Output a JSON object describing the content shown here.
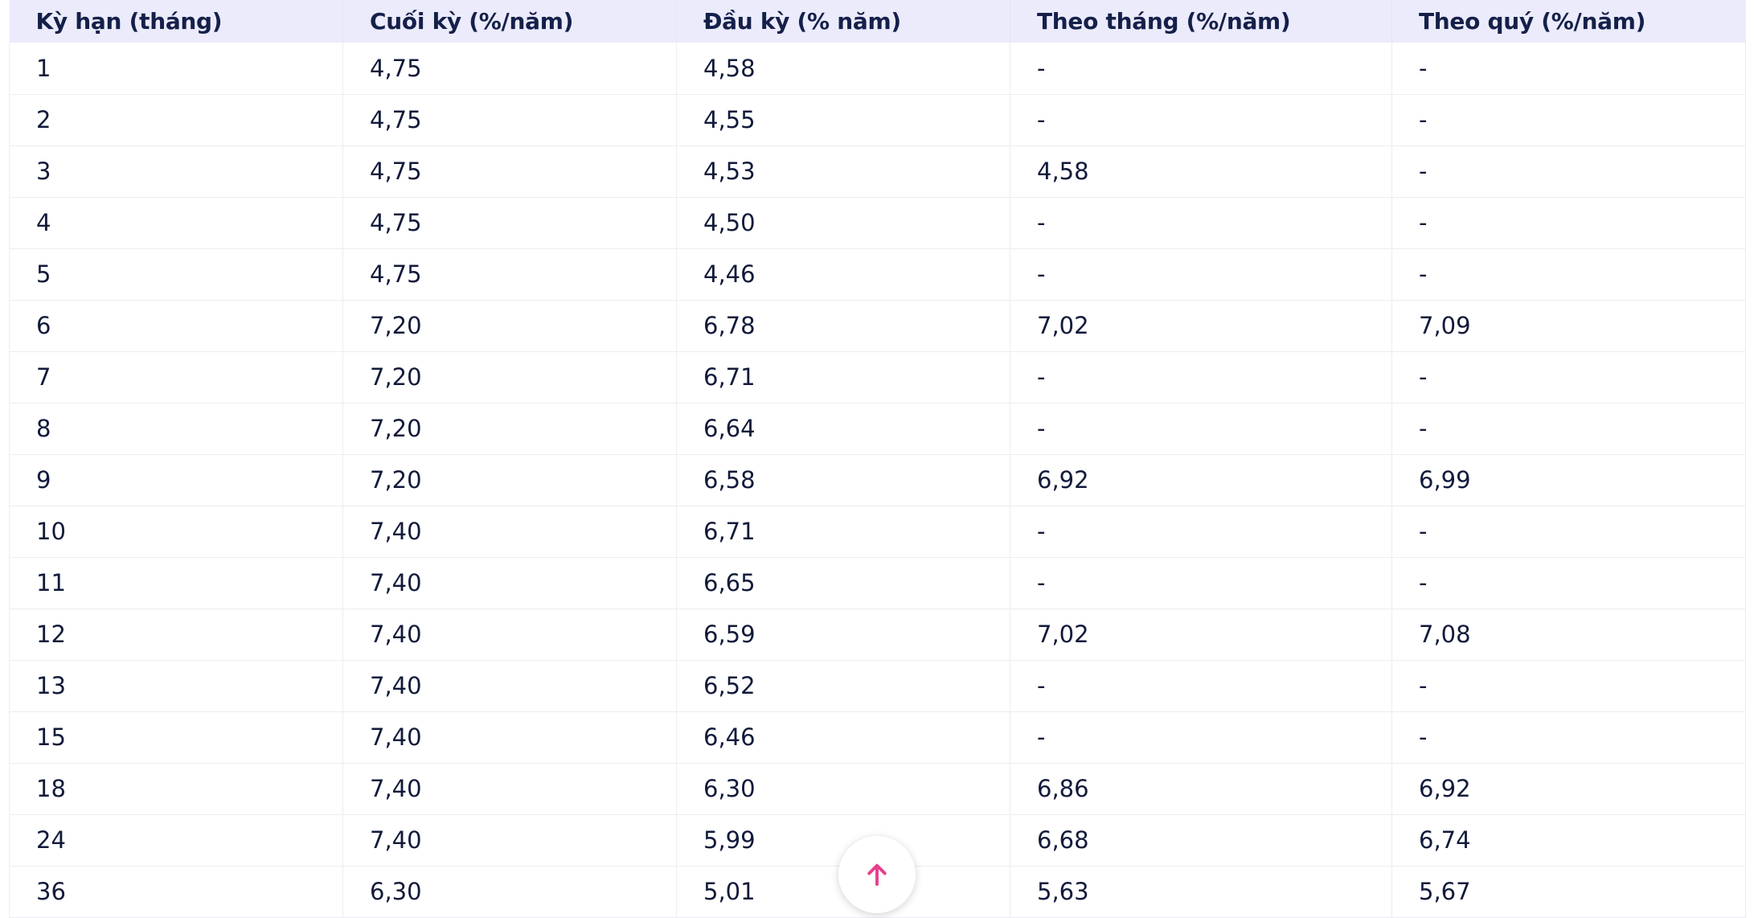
{
  "table": {
    "headers": [
      "Kỳ hạn (tháng)",
      "Cuối kỳ (%/năm)",
      "Đầu kỳ (% năm)",
      "Theo tháng (%/năm)",
      "Theo quý (%/năm)"
    ],
    "rows": [
      [
        "1",
        "4,75",
        "4,58",
        "-",
        "-"
      ],
      [
        "2",
        "4,75",
        "4,55",
        "-",
        "-"
      ],
      [
        "3",
        "4,75",
        "4,53",
        "4,58",
        "-"
      ],
      [
        "4",
        "4,75",
        "4,50",
        "-",
        "-"
      ],
      [
        "5",
        "4,75",
        "4,46",
        "-",
        "-"
      ],
      [
        "6",
        "7,20",
        "6,78",
        "7,02",
        "7,09"
      ],
      [
        "7",
        "7,20",
        "6,71",
        "-",
        "-"
      ],
      [
        "8",
        "7,20",
        "6,64",
        "-",
        "-"
      ],
      [
        "9",
        "7,20",
        "6,58",
        "6,92",
        "6,99"
      ],
      [
        "10",
        "7,40",
        "6,71",
        "-",
        "-"
      ],
      [
        "11",
        "7,40",
        "6,65",
        "-",
        "-"
      ],
      [
        "12",
        "7,40",
        "6,59",
        "7,02",
        "7,08"
      ],
      [
        "13",
        "7,40",
        "6,52",
        "-",
        "-"
      ],
      [
        "15",
        "7,40",
        "6,46",
        "-",
        "-"
      ],
      [
        "18",
        "7,40",
        "6,30",
        "6,86",
        "6,92"
      ],
      [
        "24",
        "7,40",
        "5,99",
        "6,68",
        "6,74"
      ],
      [
        "36",
        "6,30",
        "5,01",
        "5,63",
        "5,67"
      ]
    ]
  },
  "scroll_top": {
    "icon": "arrow-up-icon",
    "color": "#e83e8c"
  },
  "colors": {
    "header_bg": "#ebebfb",
    "text": "#111a3a",
    "border": "#ececf2"
  }
}
